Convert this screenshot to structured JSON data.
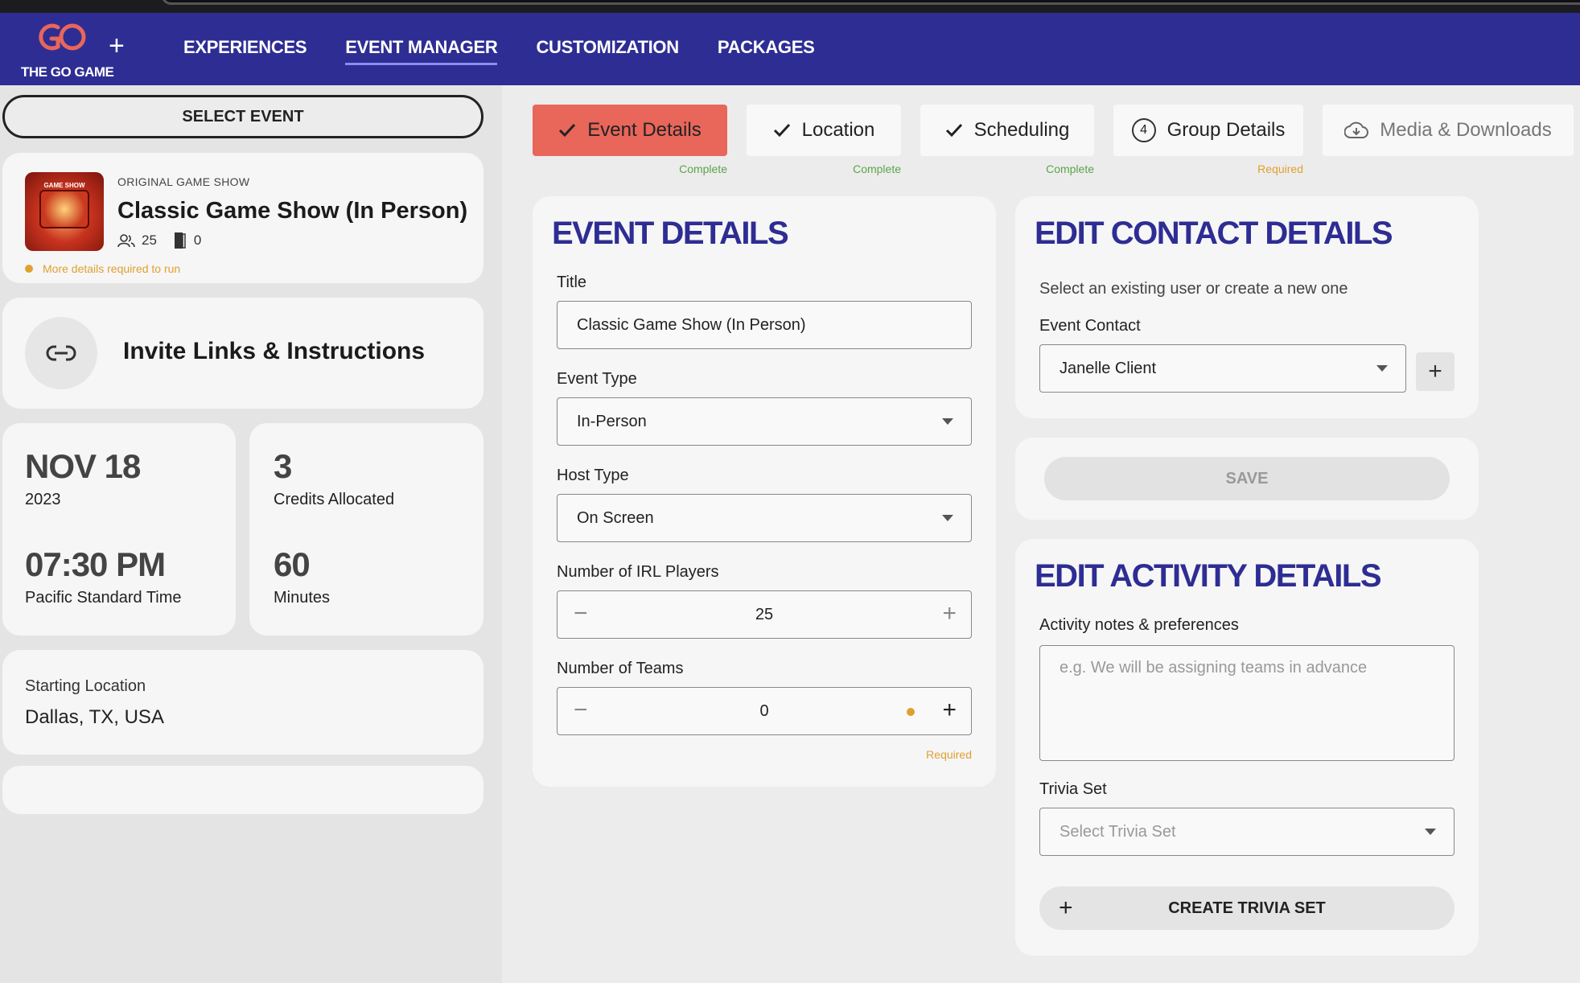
{
  "header": {
    "logo_text": "THE GO GAME",
    "nav": [
      "EXPERIENCES",
      "EVENT MANAGER",
      "CUSTOMIZATION",
      "PACKAGES"
    ]
  },
  "sidebar": {
    "select_event": "SELECT EVENT",
    "event": {
      "kicker": "ORIGINAL GAME SHOW",
      "title": "Classic Game Show (In Person)",
      "players": "25",
      "teams": "0",
      "warning": "More details required to run",
      "thumb_label": "GAME SHOW"
    },
    "invite": "Invite Links & Instructions",
    "date": "NOV 18",
    "year": "2023",
    "time": "07:30 PM",
    "timezone": "Pacific Standard Time",
    "credits": "3",
    "credits_label": "Credits Allocated",
    "minutes": "60",
    "minutes_label": "Minutes",
    "location_label": "Starting Location",
    "location": "Dallas, TX, USA"
  },
  "steps": [
    {
      "label": "Event Details",
      "status": "Complete"
    },
    {
      "label": "Location",
      "status": "Complete"
    },
    {
      "label": "Scheduling",
      "status": "Complete"
    },
    {
      "label": "Group Details",
      "status": "Required",
      "num": "4"
    },
    {
      "label": "Media & Downloads",
      "status": ""
    }
  ],
  "event_details": {
    "heading": "EVENT DETAILS",
    "title_label": "Title",
    "title_value": "Classic Game Show (In Person)",
    "type_label": "Event Type",
    "type_value": "In-Person",
    "host_label": "Host Type",
    "host_value": "On Screen",
    "players_label": "Number of IRL Players",
    "players_value": "25",
    "teams_label": "Number of Teams",
    "teams_value": "0",
    "required": "Required"
  },
  "contact": {
    "heading": "EDIT CONTACT DETAILS",
    "hint": "Select an existing user or create a new one",
    "label": "Event Contact",
    "value": "Janelle Client"
  },
  "save": "SAVE",
  "activity": {
    "heading": "EDIT ACTIVITY DETAILS",
    "notes_label": "Activity notes & preferences",
    "notes_placeholder": "e.g. We will be assigning teams in advance",
    "trivia_label": "Trivia Set",
    "trivia_placeholder": "Select Trivia Set",
    "create": "CREATE TRIVIA SET"
  },
  "colors": {
    "brand": "#2e2d93",
    "accent": "#e8665a",
    "warning": "#e0a030",
    "success": "#5aa54a"
  }
}
